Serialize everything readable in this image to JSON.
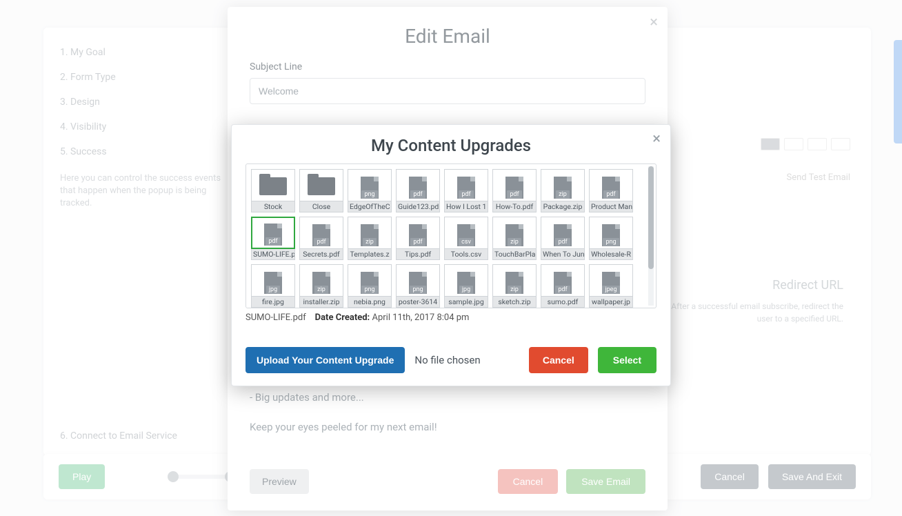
{
  "sidebar": {
    "steps": [
      {
        "num": "1.",
        "label": "My Goal"
      },
      {
        "num": "2.",
        "label": "Form Type"
      },
      {
        "num": "3.",
        "label": "Design"
      },
      {
        "num": "4.",
        "label": "Visibility"
      },
      {
        "num": "5.",
        "label": "Success"
      }
    ],
    "connect_step": {
      "num": "6.",
      "label": "Connect to Email Service"
    },
    "hint": "Here you can control the success events that happen when the popup is being tracked."
  },
  "right_panel": {
    "title": "Redirect URL",
    "body": "After a successful email subscribe, redirect the user to a specified URL.",
    "badge": "Send Test Email"
  },
  "bottom_bar": {
    "left": "Play",
    "cancel": "Cancel",
    "save_exit": "Save And Exit"
  },
  "edit_email": {
    "title": "Edit Email",
    "subject_label": "Subject Line",
    "subject_value": "Welcome",
    "body_line1": "- Big updates and more...",
    "body_line2": "Keep your eyes peeled for my next email!",
    "preview": "Preview",
    "cancel": "Cancel",
    "save": "Save Email"
  },
  "content_upgrades": {
    "title": "My Content Upgrades",
    "selected_name": "SUMO-LIFE.pdf",
    "date_label": "Date Created:",
    "date_value": "April 11th, 2017 8:04 pm",
    "upload_button": "Upload Your Content Upgrade",
    "no_file": "No file chosen",
    "cancel": "Cancel",
    "select": "Select",
    "items": [
      {
        "type": "folder",
        "label": "Stock"
      },
      {
        "type": "folder",
        "label": "Close"
      },
      {
        "type": "file",
        "ext": "png",
        "label": "EdgeOfTheC"
      },
      {
        "type": "file",
        "ext": "pdf",
        "label": "Guide123.pd"
      },
      {
        "type": "file",
        "ext": "pdf",
        "label": "How I Lost 1"
      },
      {
        "type": "file",
        "ext": "pdf",
        "label": "How-To.pdf"
      },
      {
        "type": "file",
        "ext": "zip",
        "label": "Package.zip"
      },
      {
        "type": "file",
        "ext": "pdf",
        "label": "Product Man"
      },
      {
        "type": "file",
        "ext": "pdf",
        "label": "SUMO-LIFE.p",
        "selected": true
      },
      {
        "type": "file",
        "ext": "pdf",
        "label": "Secrets.pdf"
      },
      {
        "type": "file",
        "ext": "zip",
        "label": "Templates.z"
      },
      {
        "type": "file",
        "ext": "pdf",
        "label": "Tips.pdf"
      },
      {
        "type": "file",
        "ext": "csv",
        "label": "Tools.csv"
      },
      {
        "type": "file",
        "ext": "zip",
        "label": "TouchBarPla"
      },
      {
        "type": "file",
        "ext": "pdf",
        "label": "When To Jun"
      },
      {
        "type": "file",
        "ext": "png",
        "label": "Wholesale-R"
      },
      {
        "type": "file",
        "ext": "jpg",
        "label": "fire.jpg"
      },
      {
        "type": "file",
        "ext": "zip",
        "label": "installer.zip"
      },
      {
        "type": "file",
        "ext": "png",
        "label": "nebia.png"
      },
      {
        "type": "file",
        "ext": "png",
        "label": "poster-3614"
      },
      {
        "type": "file",
        "ext": "jpg",
        "label": "sample.jpg"
      },
      {
        "type": "file",
        "ext": "zip",
        "label": "sketch.zip"
      },
      {
        "type": "file",
        "ext": "pdf",
        "label": "sumo.pdf"
      },
      {
        "type": "file",
        "ext": "jpeg",
        "label": "wallpaper.jp"
      }
    ]
  }
}
